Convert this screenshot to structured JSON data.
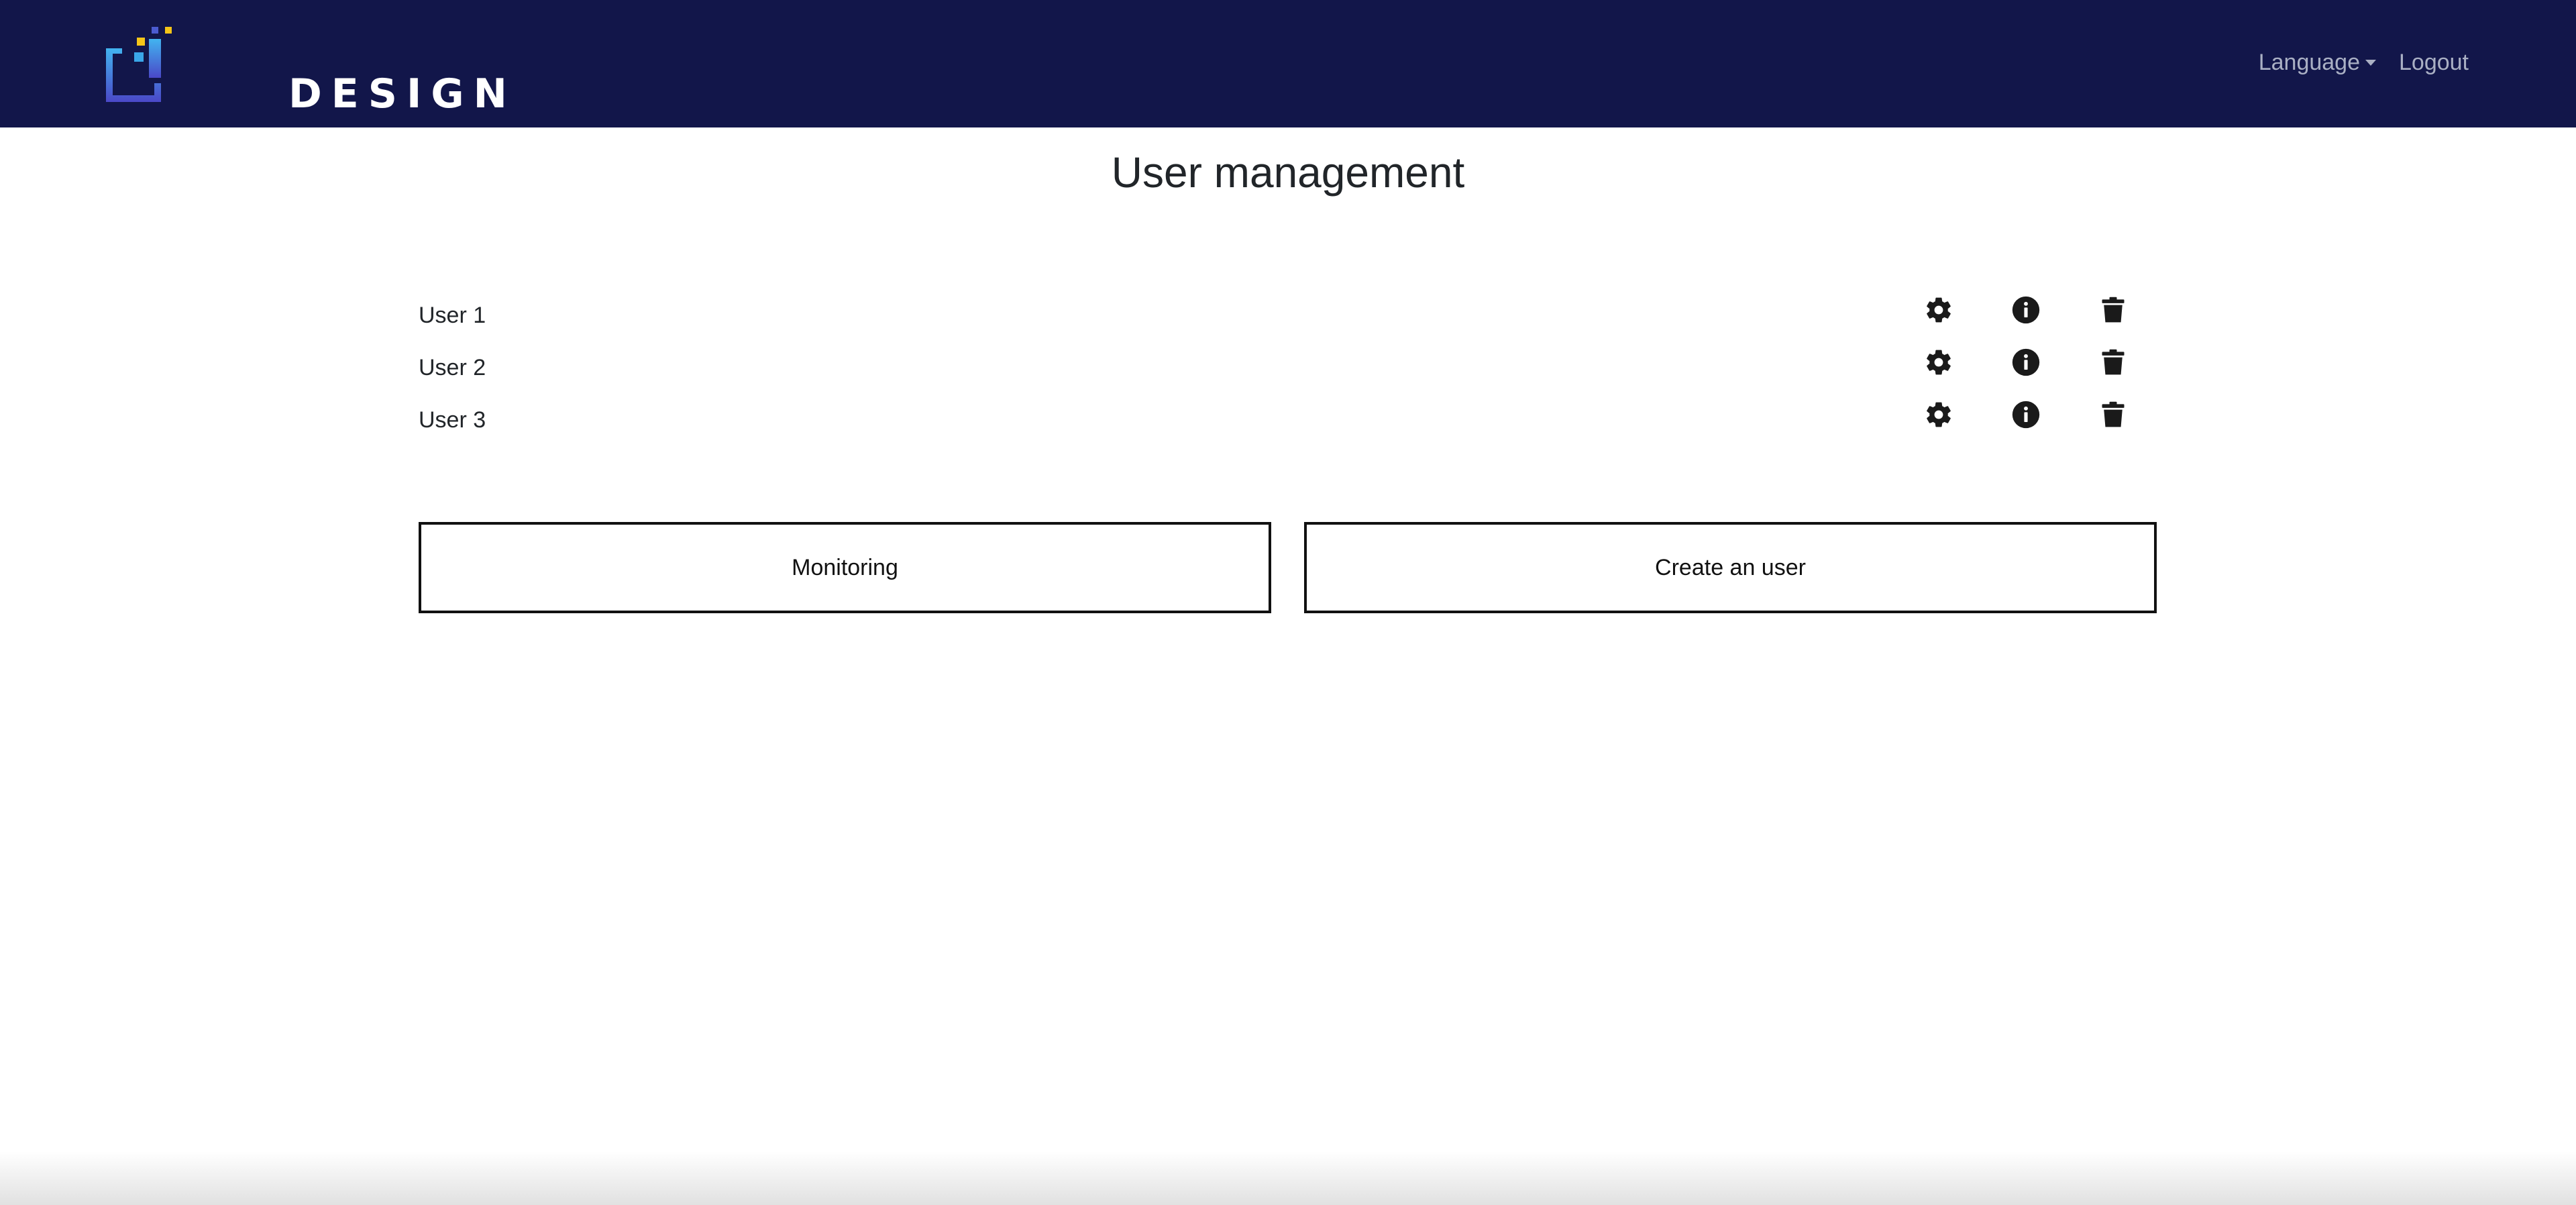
{
  "navbar": {
    "brand": "DESIGN",
    "language_label": "Language",
    "logout_label": "Logout",
    "background_color": "#12164a",
    "logo_colors": [
      "#3aa6e8",
      "#f5c518",
      "#4b5bd0"
    ]
  },
  "page": {
    "title": "User management"
  },
  "users": [
    {
      "name": "User 1",
      "actions": [
        "gear-icon",
        "info-icon",
        "trash-icon"
      ]
    },
    {
      "name": "User 2",
      "actions": [
        "gear-icon",
        "info-icon",
        "trash-icon"
      ]
    },
    {
      "name": "User 3",
      "actions": [
        "gear-icon",
        "info-icon",
        "trash-icon"
      ]
    }
  ],
  "buttons": {
    "monitoring_label": "Monitoring",
    "create_user_label": "Create an user"
  }
}
